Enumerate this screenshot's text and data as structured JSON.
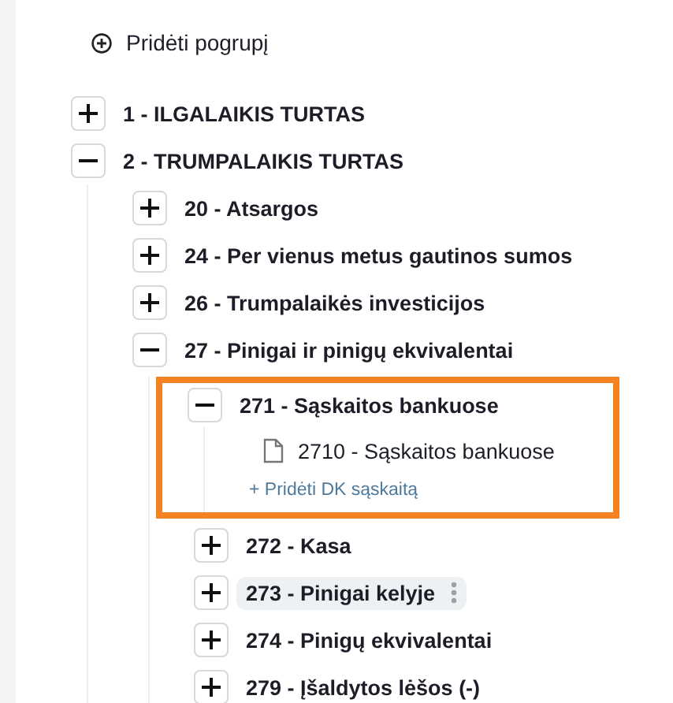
{
  "add_subgroup": {
    "label": "Pridėti pogrupį"
  },
  "tree": [
    {
      "kind": "group",
      "label": "1 - ILGALAIKIS TURTAS",
      "expanded": false
    },
    {
      "kind": "group",
      "label": "2 - TRUMPALAIKIS TURTAS",
      "expanded": true,
      "children": [
        {
          "kind": "group",
          "label": "20 - Atsargos",
          "expanded": false
        },
        {
          "kind": "group",
          "label": "24 - Per vienus metus gautinos sumos",
          "expanded": false
        },
        {
          "kind": "group",
          "label": "26 - Trumpalaikės investicijos",
          "expanded": false
        },
        {
          "kind": "group",
          "label": "27 - Pinigai ir pinigų ekvivalentai",
          "expanded": true,
          "children": [
            {
              "kind": "group",
              "label": "271 - Sąskaitos bankuose",
              "expanded": true,
              "highlighted": true,
              "children": [
                {
                  "kind": "account",
                  "label": "2710 - Sąskaitos bankuose"
                },
                {
                  "kind": "add_link",
                  "label": "+ Pridėti DK sąskaitą"
                }
              ]
            },
            {
              "kind": "group",
              "label": "272 - Kasa",
              "expanded": false
            },
            {
              "kind": "group",
              "label": "273 - Pinigai kelyje",
              "expanded": false,
              "hovered": true
            },
            {
              "kind": "group",
              "label": "274 - Pinigų ekvivalentai",
              "expanded": false
            },
            {
              "kind": "group",
              "label": "279 - Įšaldytos lėšos (-)",
              "expanded": false
            }
          ]
        }
      ]
    }
  ]
}
